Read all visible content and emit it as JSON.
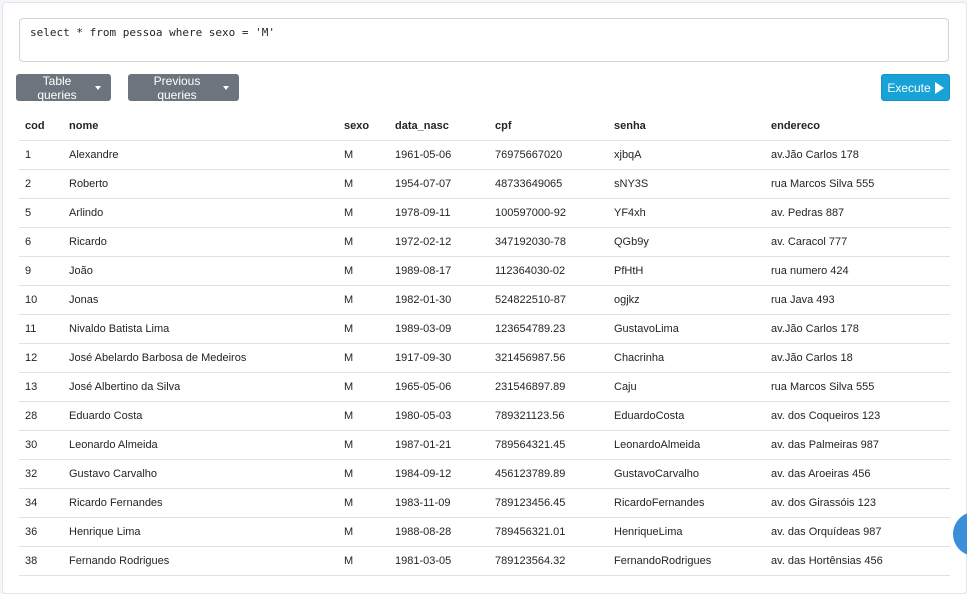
{
  "query": {
    "value": "select * from pessoa where sexo = 'M'"
  },
  "toolbar": {
    "table_queries_label": "Table queries",
    "previous_queries_label": "Previous queries",
    "execute_label": "Execute"
  },
  "table": {
    "columns": [
      "cod",
      "nome",
      "sexo",
      "data_nasc",
      "cpf",
      "senha",
      "endereco"
    ],
    "rows": [
      [
        "1",
        "Alexandre",
        "M",
        "1961-05-06",
        "76975667020",
        "xjbqA",
        "av.Jão Carlos 178"
      ],
      [
        "2",
        "Roberto",
        "M",
        "1954-07-07",
        "48733649065",
        "sNY3S",
        "rua Marcos Silva 555"
      ],
      [
        "5",
        "Arlindo",
        "M",
        "1978-09-11",
        "100597000-92",
        "YF4xh",
        "av. Pedras 887"
      ],
      [
        "6",
        "Ricardo",
        "M",
        "1972-02-12",
        "347192030-78",
        "QGb9y",
        "av. Caracol 777"
      ],
      [
        "9",
        "João",
        "M",
        "1989-08-17",
        "112364030-02",
        "PfHtH",
        "rua numero 424"
      ],
      [
        "10",
        "Jonas",
        "M",
        "1982-01-30",
        "524822510-87",
        "ogjkz",
        "rua Java 493"
      ],
      [
        "11",
        "Nivaldo Batista Lima",
        "M",
        "1989-03-09",
        "123654789.23",
        "GustavoLima",
        "av.Jão Carlos 178"
      ],
      [
        "12",
        "José Abelardo Barbosa de Medeiros",
        "M",
        "1917-09-30",
        "321456987.56",
        "Chacrinha",
        "av.Jão Carlos 18"
      ],
      [
        "13",
        "José Albertino da Silva",
        "M",
        "1965-05-06",
        "231546897.89",
        "Caju",
        "rua Marcos Silva 555"
      ],
      [
        "28",
        "Eduardo Costa",
        "M",
        "1980-05-03",
        "789321123.56",
        "EduardoCosta",
        "av. dos Coqueiros 123"
      ],
      [
        "30",
        "Leonardo Almeida",
        "M",
        "1987-01-21",
        "789564321.45",
        "LeonardoAlmeida",
        "av. das Palmeiras 987"
      ],
      [
        "32",
        "Gustavo Carvalho",
        "M",
        "1984-09-12",
        "456123789.89",
        "GustavoCarvalho",
        "av. das Aroeiras 456"
      ],
      [
        "34",
        "Ricardo Fernandes",
        "M",
        "1983-11-09",
        "789123456.45",
        "RicardoFernandes",
        "av. dos Girassóis 123"
      ],
      [
        "36",
        "Henrique Lima",
        "M",
        "1988-08-28",
        "789456321.01",
        "HenriqueLima",
        "av. das Orquídeas 987"
      ],
      [
        "38",
        "Fernando Rodrigues",
        "M",
        "1981-03-05",
        "789123564.32",
        "FernandoRodrigues",
        "av. das Hortênsias 456"
      ]
    ]
  },
  "colors": {
    "secondary_button": "#6c757d",
    "execute_button": "#17a2d8",
    "fab": "#3b8fd9"
  },
  "icons": {
    "dropdown": "caret-down-icon",
    "execute": "play-icon"
  }
}
